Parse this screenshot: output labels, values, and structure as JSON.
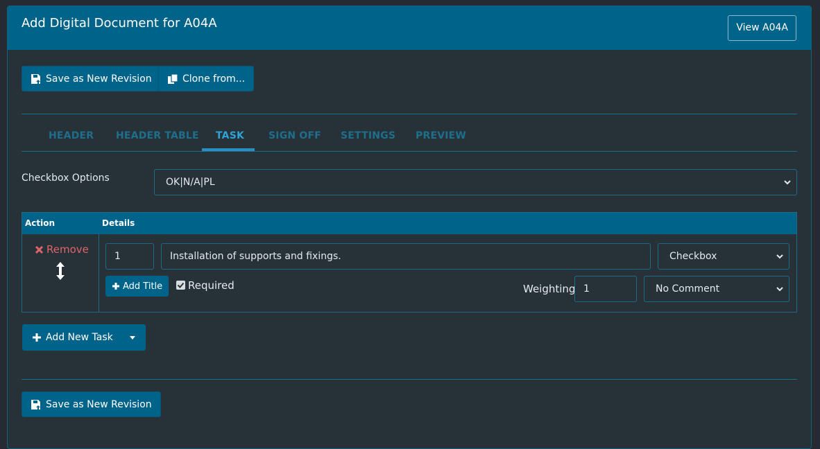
{
  "header": {
    "title": "Add Digital Document for A04A",
    "view_button": "View A04A"
  },
  "toolbar": {
    "save_label": "Save as New Revision",
    "clone_label": "Clone from..."
  },
  "tabs": [
    {
      "label": "HEADER"
    },
    {
      "label": "HEADER TABLE"
    },
    {
      "label": "TASK"
    },
    {
      "label": "SIGN OFF"
    },
    {
      "label": "SETTINGS"
    },
    {
      "label": "PREVIEW"
    }
  ],
  "active_tab": "TASK",
  "checkbox_options": {
    "label": "Checkbox Options",
    "value": "OK|N/A|PL"
  },
  "task_table": {
    "columns": [
      "Action",
      "Details"
    ],
    "rows": [
      {
        "remove_label": "Remove",
        "number": "1",
        "description": "Installation of supports and fixings.",
        "type": "Checkbox",
        "add_title_label": "Add Title",
        "required_label": "Required",
        "required": true,
        "weighting_label": "Weighting",
        "weighting": "1",
        "comment": "No Comment"
      }
    ]
  },
  "add_task_label": "Add New Task",
  "footer": {
    "save_label": "Save as New Revision"
  },
  "colors": {
    "accent": "#00638a",
    "tab_active": "#2fa3d6",
    "remove": "#e0636a"
  }
}
